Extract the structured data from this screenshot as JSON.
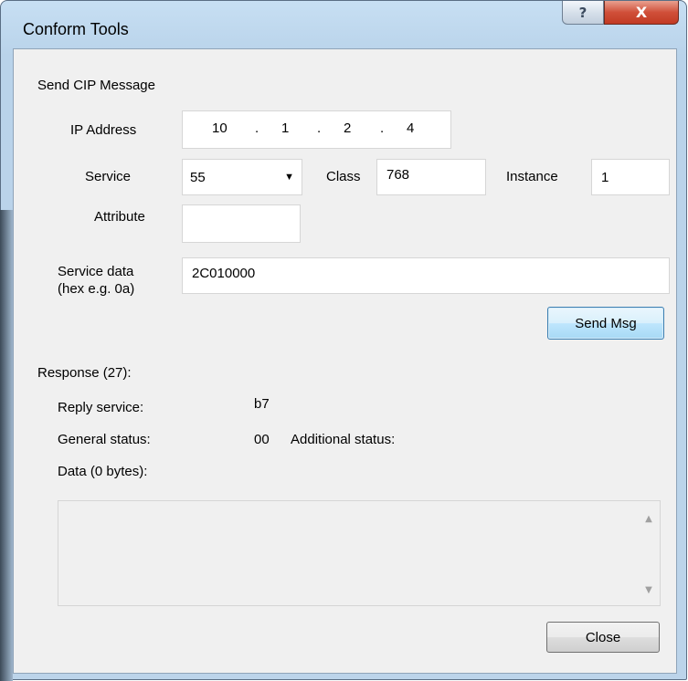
{
  "window": {
    "title": "Conform Tools",
    "help_glyph": "?",
    "close_glyph": "X"
  },
  "form": {
    "section_title": "Send CIP Message",
    "ip_label": "IP Address",
    "ip_octets": [
      "10",
      "1",
      "2",
      "4"
    ],
    "ip_separator": ".",
    "service_label": "Service",
    "service_value": "55",
    "class_label": "Class",
    "class_value": "768",
    "instance_label": "Instance",
    "instance_value": "1",
    "attribute_label": "Attribute",
    "attribute_value": "",
    "service_data_label_1": "Service data",
    "service_data_label_2": "(hex e.g. 0a)",
    "service_data_value": "2C010000",
    "send_button": "Send Msg"
  },
  "response": {
    "title": "Response (27):",
    "reply_service_label": "Reply service:",
    "reply_service_value": "b7",
    "general_status_label": "General status:",
    "general_status_value": "00",
    "additional_status_label": "Additional status:",
    "additional_status_value": "",
    "data_label": "Data (0 bytes):",
    "data_value": ""
  },
  "footer": {
    "close_button": "Close"
  },
  "icons": {
    "dropdown": "chevron-down-icon",
    "scroll_up": "scroll-up-arrow-icon",
    "scroll_down": "scroll-down-arrow-icon"
  }
}
